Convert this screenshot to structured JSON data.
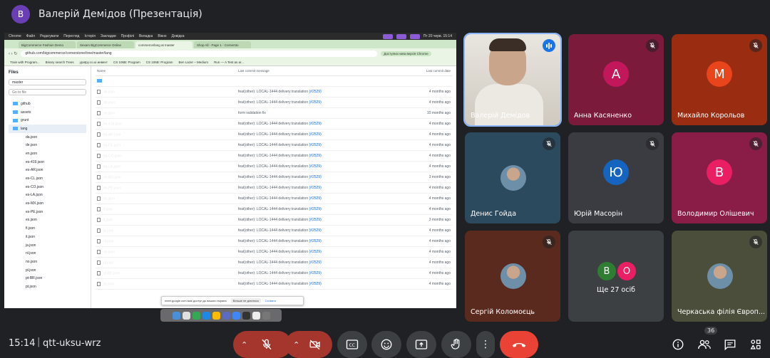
{
  "presenter": {
    "initial": "В",
    "title": "Валерій Демідов (Презентація)"
  },
  "shared_screen": {
    "mac_menu": [
      "Chrome",
      "Файл",
      "Редагувати",
      "Перегляд",
      "Історія",
      "Закладки",
      "Профілі",
      "Вкладка",
      "Вікно",
      "Довідка"
    ],
    "mac_clock": "Пт 20 черв. 15:14",
    "tabs": [
      "BigCommerce Fashion Demo",
      "Sexam BigCommerce Online",
      "commerce/lang at master",
      "Shop All - Page 1 - Cornersto"
    ],
    "url": "github.com/bigcommerce/cornerstone/tree/master/lang",
    "update_label": "Доступна нова версія Chrome",
    "bookmarks": [
      "Train with Program...",
      "Binary search Trees",
      "ypatpy.co.ui инвент",
      "CS 106B: Program",
      "CS 106B: Program",
      "Ben Lazer – Medium",
      "Run — A Test as ar..."
    ],
    "sidebar": {
      "title": "Files",
      "branch": "master",
      "goto_placeholder": "Go to file",
      "tree": [
        {
          "name": "github",
          "level": 1
        },
        {
          "name": "assets",
          "level": 1
        },
        {
          "name": "grunt",
          "level": 1
        },
        {
          "name": "lang",
          "level": 1,
          "selected": true
        },
        {
          "name": "da.json",
          "level": 2
        },
        {
          "name": "de.json",
          "level": 2
        },
        {
          "name": "en.json",
          "level": 2
        },
        {
          "name": "es-419.json",
          "level": 2
        },
        {
          "name": "es-AR.json",
          "level": 2
        },
        {
          "name": "es-CL.json",
          "level": 2
        },
        {
          "name": "es-CO.json",
          "level": 2
        },
        {
          "name": "es-LA.json",
          "level": 2
        },
        {
          "name": "es-MX.json",
          "level": 2
        },
        {
          "name": "es-PE.json",
          "level": 2
        },
        {
          "name": "es.json",
          "level": 2
        },
        {
          "name": "fi.json",
          "level": 2
        },
        {
          "name": "it.json",
          "level": 2
        },
        {
          "name": "ja.json",
          "level": 2
        },
        {
          "name": "nl.json",
          "level": 2
        },
        {
          "name": "no.json",
          "level": 2
        },
        {
          "name": "pl.json",
          "level": 2
        },
        {
          "name": "pt-BR.json",
          "level": 2
        },
        {
          "name": "pt.json",
          "level": 2
        }
      ]
    },
    "table": {
      "headers": [
        "Name",
        "Last commit message",
        "Last commit date"
      ],
      "folder_row": "..",
      "rows": [
        {
          "name": "da.json",
          "msg": "feat(other): LOCAL-1444 delivery translation",
          "pr": "(#2529)",
          "date": "4 months ago"
        },
        {
          "name": "de.json",
          "msg": "feat(other): LOCAL-1444 delivery translation",
          "pr": "(#2529)",
          "date": "4 months ago"
        },
        {
          "name": "en.json",
          "msg": "form validation fix",
          "pr": "",
          "date": "10 months ago"
        },
        {
          "name": "es-419.json",
          "msg": "feat(other): LOCAL-1444 delivery translation",
          "pr": "(#2529)",
          "date": "4 months ago"
        },
        {
          "name": "es-AR.json",
          "msg": "feat(other): LOCAL-1444 delivery translation",
          "pr": "(#2529)",
          "date": "4 months ago"
        },
        {
          "name": "es-CL.json",
          "msg": "feat(other): LOCAL-1444 delivery translation",
          "pr": "(#2529)",
          "date": "4 months ago"
        },
        {
          "name": "es-CO.json",
          "msg": "feat(other): LOCAL-1444 delivery translation",
          "pr": "(#2529)",
          "date": "4 months ago"
        },
        {
          "name": "es-LA.json",
          "msg": "feat(other): LOCAL-1444 delivery translation",
          "pr": "(#2529)",
          "date": "4 months ago"
        },
        {
          "name": "es-MX.json",
          "msg": "feat(other): LOCAL-1444 delivery translation",
          "pr": "(#2529)",
          "date": "3 months ago"
        },
        {
          "name": "es-PE.json",
          "msg": "feat(other): LOCAL-1444 delivery translation",
          "pr": "(#2529)",
          "date": "4 months ago"
        },
        {
          "name": "es.json",
          "msg": "feat(other): LOCAL-1444 delivery translation",
          "pr": "(#2529)",
          "date": "4 months ago"
        },
        {
          "name": "fi.json",
          "msg": "feat(other): LOCAL-1444 delivery translation",
          "pr": "(#2529)",
          "date": "4 months ago"
        },
        {
          "name": "it.json",
          "msg": "feat(other): LOCAL-1444 delivery translation",
          "pr": "(#2529)",
          "date": "3 months ago"
        },
        {
          "name": "ja.json",
          "msg": "feat(other): LOCAL-1444 delivery translation",
          "pr": "(#2529)",
          "date": "4 months ago"
        },
        {
          "name": "nl.json",
          "msg": "feat(other): LOCAL-1444 delivery translation",
          "pr": "(#2529)",
          "date": "4 months ago"
        },
        {
          "name": "nn.json",
          "msg": "feat(other): LOCAL-1444 delivery translation",
          "pr": "(#2529)",
          "date": "4 months ago"
        },
        {
          "name": "pl.json",
          "msg": "feat(other): LOCAL-1444 delivery translation",
          "pr": "(#2529)",
          "date": "4 months ago"
        },
        {
          "name": "pt-BR.json",
          "msg": "feat(other): LOCAL-1444 delivery translation",
          "pr": "(#2529)",
          "date": "4 months ago"
        },
        {
          "name": "pt.json",
          "msg": "feat(other): LOCAL-1444 delivery translation",
          "pr": "(#2529)",
          "date": "4 months ago"
        }
      ]
    },
    "toast": {
      "text": "meet.google.com має доступ до вашого екрана",
      "stop": "Більше не ділитися",
      "hide": "Сховати"
    }
  },
  "participants": [
    {
      "name": "Валерій Демідов",
      "type": "video",
      "speaking": true
    },
    {
      "name": "Анна Касяненко",
      "initial": "А",
      "color": "#c2185b",
      "bg": "#7b1a3b",
      "muted": true
    },
    {
      "name": "Михайло Корольов",
      "initial": "М",
      "color": "#e8451c",
      "bg": "#9a2c12",
      "muted": true
    },
    {
      "name": "Денис Гойда",
      "type": "photo",
      "bg": "#2c4a5e",
      "muted": true
    },
    {
      "name": "Юрій Масорін",
      "initial": "Ю",
      "color": "#1565c0",
      "bg": "#3b3b42",
      "muted": true
    },
    {
      "name": "Володимир Олішевич",
      "initial": "В",
      "color": "#e91e63",
      "bg": "#8a1d48",
      "muted": true
    },
    {
      "name": "Сергій Коломоєць",
      "type": "photo",
      "bg": "#5a2a1e",
      "muted": true
    },
    {
      "name": "Ще 27 осіб",
      "type": "group",
      "initials": [
        "В",
        "О"
      ],
      "colors": [
        "#2e7d32",
        "#e91e63"
      ],
      "bg": "#3c4043"
    },
    {
      "name": "Черкаська філія Європ...",
      "type": "photo",
      "bg": "#4a4e3a",
      "muted": true
    }
  ],
  "bottom": {
    "time": "15:14",
    "separator": "|",
    "code": "qtt-uksu-wrz",
    "people_count": "36"
  },
  "colors": {
    "danger": "#ea4335",
    "control": "#3c4043",
    "muted_danger": "#a5362d"
  }
}
